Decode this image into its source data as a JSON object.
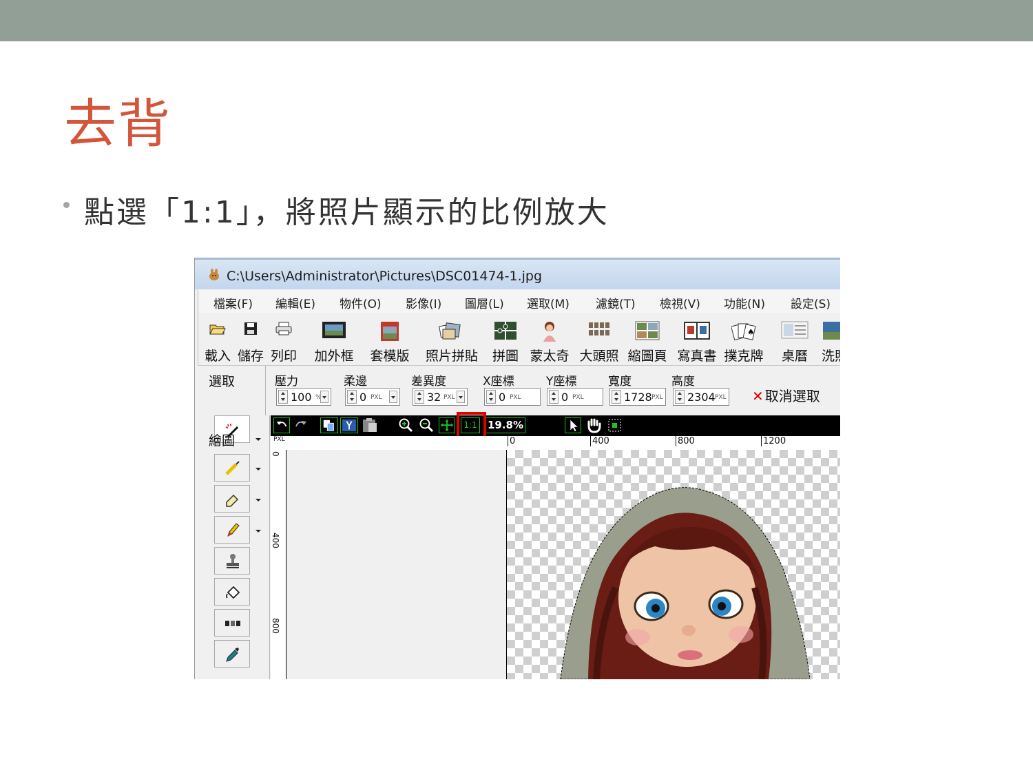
{
  "slide": {
    "title": "去背",
    "bullet": "點選「1:1」，將照片顯示的比例放大"
  },
  "colors": {
    "title": "#d3553a",
    "header_band": "#919f97",
    "highlight": "#e00000",
    "canvas_bar": "#000000"
  },
  "app": {
    "title": "C:\\Users\\Administrator\\Pictures\\DSC01474-1.jpg",
    "menu": [
      "檔案(F)",
      "編輯(E)",
      "物件(O)",
      "影像(I)",
      "圖層(L)",
      "選取(M)",
      "濾鏡(T)",
      "檢視(V)",
      "功能(N)",
      "設定(S)"
    ],
    "toolbar": [
      {
        "label": "載入",
        "icon": "open-folder-icon"
      },
      {
        "label": "儲存",
        "icon": "save-icon"
      },
      {
        "label": "列印",
        "icon": "print-icon"
      },
      {
        "label": "加外框",
        "icon": "frame-icon"
      },
      {
        "label": "套模版",
        "icon": "template-icon"
      },
      {
        "label": "照片拼貼",
        "icon": "collage-icon"
      },
      {
        "label": "拼圖",
        "icon": "puzzle-icon"
      },
      {
        "label": "蒙太奇",
        "icon": "montage-icon"
      },
      {
        "label": "大頭照",
        "icon": "id-photo-icon"
      },
      {
        "label": "縮圖頁",
        "icon": "thumbnail-icon"
      },
      {
        "label": "寫真書",
        "icon": "photobook-icon"
      },
      {
        "label": "撲克牌",
        "icon": "poker-icon"
      },
      {
        "label": "桌曆",
        "icon": "calendar-icon"
      },
      {
        "label": "洗照",
        "icon": "print-photo-icon"
      }
    ],
    "options": {
      "section_select": "選取",
      "section_draw": "繪圖",
      "pressure": {
        "label": "壓力",
        "value": "100",
        "unit": "%"
      },
      "feather": {
        "label": "柔邊",
        "value": "0",
        "unit": "PXL"
      },
      "tolerance": {
        "label": "差異度",
        "value": "32",
        "unit": "PXL"
      },
      "x": {
        "label": "X座標",
        "value": "0",
        "unit": "PXL"
      },
      "y": {
        "label": "Y座標",
        "value": "0",
        "unit": "PXL"
      },
      "width": {
        "label": "寬度",
        "value": "1728",
        "unit": "PXL"
      },
      "height": {
        "label": "高度",
        "value": "2304",
        "unit": "PXL"
      },
      "cancel": "取消選取"
    },
    "canvas": {
      "zoom": "19.8%",
      "one_to_one": "1:1",
      "ruler_unit": "PXL",
      "ruler_top": [
        "0",
        "400",
        "800",
        "1200"
      ],
      "ruler_left": [
        "0",
        "400",
        "800"
      ]
    }
  }
}
